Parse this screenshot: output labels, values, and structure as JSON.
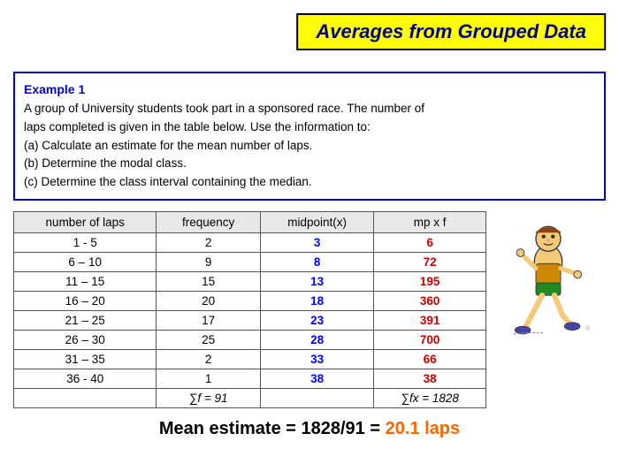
{
  "title": "Averages from Grouped Data",
  "example": {
    "label": "Example 1",
    "text1": "A group of University students took part in a sponsored race. The number of",
    "text2": "laps completed is given in the table below. Use the information to:",
    "text3": "(a) Calculate an estimate for the mean number of laps.",
    "text4": "(b) Determine the modal class.",
    "text5": "(c) Determine the class interval containing the median."
  },
  "table": {
    "headers": [
      "number of laps",
      "frequency",
      "midpoint(x)",
      "mp x f"
    ],
    "rows": [
      {
        "laps": "1 - 5",
        "freq": "2",
        "mid": "3",
        "mpf": "6"
      },
      {
        "laps": "6 – 10",
        "freq": "9",
        "mid": "8",
        "mpf": "72"
      },
      {
        "laps": "11 – 15",
        "freq": "15",
        "mid": "13",
        "mpf": "195"
      },
      {
        "laps": "16 – 20",
        "freq": "20",
        "mid": "18",
        "mpf": "360"
      },
      {
        "laps": "21 – 25",
        "freq": "17",
        "mid": "23",
        "mpf": "391"
      },
      {
        "laps": "26 – 30",
        "freq": "25",
        "mid": "28",
        "mpf": "700"
      },
      {
        "laps": "31 – 35",
        "freq": "2",
        "mid": "33",
        "mpf": "66"
      },
      {
        "laps": "36 - 40",
        "freq": "1",
        "mid": "38",
        "mpf": "38"
      }
    ],
    "sum_freq": "∑f = 91",
    "sum_mpf": "∑fx = 1828"
  },
  "mean_estimate": {
    "prefix": "Mean estimate = 1828/91 = ",
    "value": "20.1 laps"
  }
}
